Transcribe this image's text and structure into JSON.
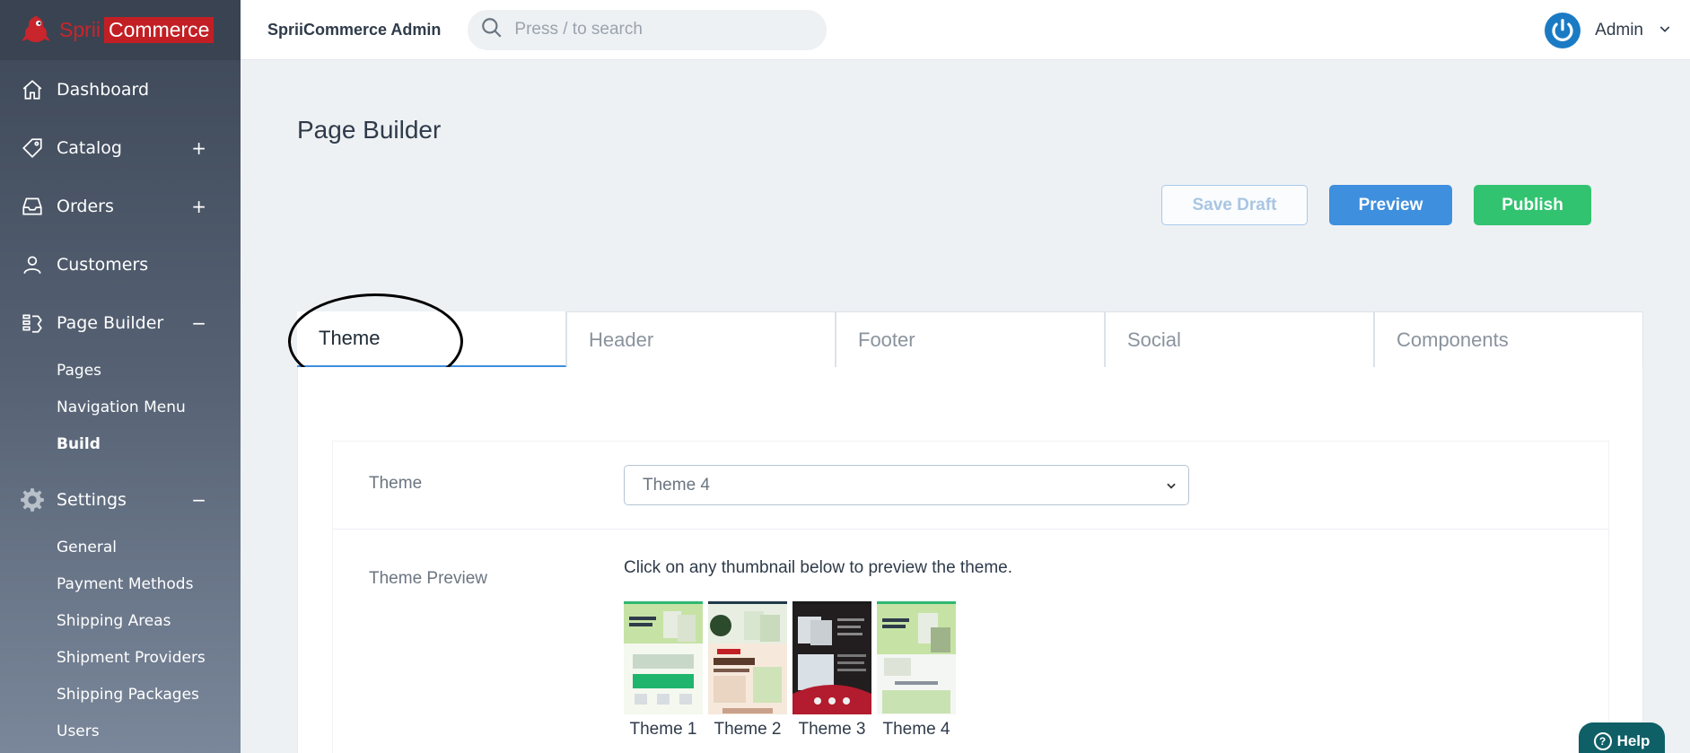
{
  "brand": {
    "logo_part1": "Sprii",
    "logo_part2": "Commerce",
    "app_title": "SpriiCommerce Admin"
  },
  "search": {
    "placeholder": "Press / to search"
  },
  "user": {
    "name": "Admin"
  },
  "sidebar": {
    "dashboard": "Dashboard",
    "catalog": "Catalog",
    "orders": "Orders",
    "customers": "Customers",
    "page_builder": "Page Builder",
    "pb_sub": [
      "Pages",
      "Navigation Menu",
      "Build"
    ],
    "settings": "Settings",
    "settings_sub": [
      "General",
      "Payment Methods",
      "Shipping Areas",
      "Shipment Providers",
      "Shipping Packages",
      "Users"
    ],
    "toggle_plus": "+",
    "toggle_minus": "−"
  },
  "main": {
    "title": "Page Builder",
    "save_draft": "Save Draft",
    "preview": "Preview",
    "publish": "Publish",
    "tabs": [
      "Theme",
      "Header",
      "Footer",
      "Social",
      "Components"
    ],
    "theme_label": "Theme",
    "theme_selected": "Theme 4",
    "preview_label": "Theme Preview",
    "hint": "Click on any thumbnail below to preview the theme.",
    "thumbnails": [
      "Theme 1",
      "Theme 2",
      "Theme 3",
      "Theme 4"
    ]
  },
  "help": {
    "label": "Help"
  },
  "colors": {
    "primary": "#3e8fde",
    "success": "#32c371",
    "brand_red": "#c21f24",
    "help": "#0f5f66"
  }
}
